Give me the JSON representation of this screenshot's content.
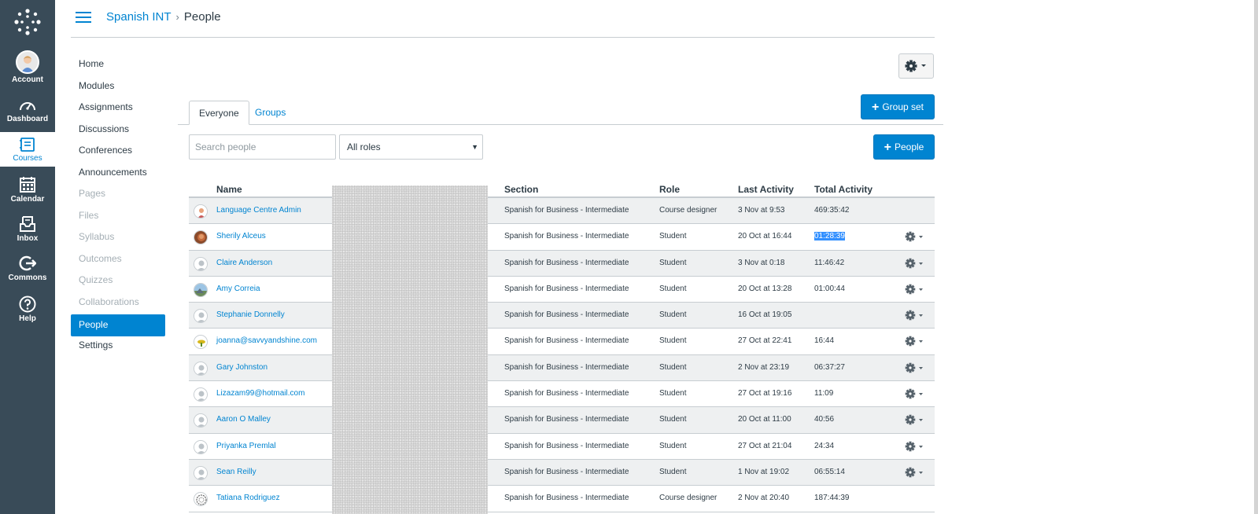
{
  "global_nav": [
    {
      "label": "Account",
      "icon": "account-avatar"
    },
    {
      "label": "Dashboard",
      "icon": "dashboard-icon"
    },
    {
      "label": "Courses",
      "icon": "courses-icon",
      "active": true
    },
    {
      "label": "Calendar",
      "icon": "calendar-icon"
    },
    {
      "label": "Inbox",
      "icon": "inbox-icon"
    },
    {
      "label": "Commons",
      "icon": "commons-icon"
    },
    {
      "label": "Help",
      "icon": "help-icon"
    }
  ],
  "breadcrumb": {
    "course": "Spanish INT",
    "separator": "›",
    "current": "People"
  },
  "course_nav": [
    {
      "label": "Home"
    },
    {
      "label": "Modules"
    },
    {
      "label": "Assignments"
    },
    {
      "label": "Discussions"
    },
    {
      "label": "Conferences"
    },
    {
      "label": "Announcements"
    },
    {
      "label": "Pages",
      "disabled": true
    },
    {
      "label": "Files",
      "disabled": true
    },
    {
      "label": "Syllabus",
      "disabled": true
    },
    {
      "label": "Outcomes",
      "disabled": true
    },
    {
      "label": "Quizzes",
      "disabled": true
    },
    {
      "label": "Collaborations",
      "disabled": true
    },
    {
      "label": "People",
      "active": true
    },
    {
      "label": "Settings"
    }
  ],
  "tabs": {
    "everyone": "Everyone",
    "groups": "Groups"
  },
  "buttons": {
    "group_set": "Group set",
    "people": "People",
    "plus": "+"
  },
  "filters": {
    "search_placeholder": "Search people",
    "role_selected": "All roles"
  },
  "table": {
    "headers": {
      "name": "Name",
      "section": "Section",
      "role": "Role",
      "last_activity": "Last Activity",
      "total_activity": "Total Activity"
    },
    "rows": [
      {
        "name": "Language Centre Admin",
        "section": "Spanish for Business - Intermediate",
        "role": "Course designer",
        "last": "3 Nov at 9:53",
        "total": "469:35:42",
        "gear": false,
        "avatar": "custom"
      },
      {
        "name": "Sherily Alceus",
        "section": "Spanish for Business - Intermediate",
        "role": "Student",
        "last": "20 Oct at 16:44",
        "total": "01:28:39",
        "gear": true,
        "avatar": "photo",
        "selected": true
      },
      {
        "name": "Claire Anderson",
        "section": "Spanish for Business - Intermediate",
        "role": "Student",
        "last": "3 Nov at 0:18",
        "total": "11:46:42",
        "gear": true,
        "avatar": "default"
      },
      {
        "name": "Amy Correia",
        "section": "Spanish for Business - Intermediate",
        "role": "Student",
        "last": "20 Oct at 13:28",
        "total": "01:00:44",
        "gear": true,
        "avatar": "landscape"
      },
      {
        "name": "Stephanie Donnelly",
        "section": "Spanish for Business - Intermediate",
        "role": "Student",
        "last": "16 Oct at 19:05",
        "total": "",
        "gear": true,
        "avatar": "default"
      },
      {
        "name": "joanna@savvyandshine.com",
        "section": "Spanish for Business - Intermediate",
        "role": "Student",
        "last": "27 Oct at 22:41",
        "total": "16:44",
        "gear": true,
        "avatar": "logo"
      },
      {
        "name": "Gary Johnston",
        "section": "Spanish for Business - Intermediate",
        "role": "Student",
        "last": "2 Nov at 23:19",
        "total": "06:37:27",
        "gear": true,
        "avatar": "default"
      },
      {
        "name": "Lizazam99@hotmail.com",
        "section": "Spanish for Business - Intermediate",
        "role": "Student",
        "last": "27 Oct at 19:16",
        "total": "11:09",
        "gear": true,
        "avatar": "default"
      },
      {
        "name": "Aaron O Malley",
        "section": "Spanish for Business - Intermediate",
        "role": "Student",
        "last": "20 Oct at 11:00",
        "total": "40:56",
        "gear": true,
        "avatar": "default"
      },
      {
        "name": "Priyanka Premlal",
        "section": "Spanish for Business - Intermediate",
        "role": "Student",
        "last": "27 Oct at 21:04",
        "total": "24:34",
        "gear": true,
        "avatar": "default"
      },
      {
        "name": "Sean Reilly",
        "section": "Spanish for Business - Intermediate",
        "role": "Student",
        "last": "1 Nov at 19:02",
        "total": "06:55:14",
        "gear": true,
        "avatar": "default"
      },
      {
        "name": "Tatiana Rodriguez",
        "section": "Spanish for Business - Intermediate",
        "role": "Course designer",
        "last": "2 Nov at 20:40",
        "total": "187:44:39",
        "gear": false,
        "avatar": "pattern"
      }
    ]
  },
  "colors": {
    "accent": "#0084d1",
    "nav_bg": "#394b58",
    "row_alt": "#eef0f1",
    "selection": "#3390ff"
  }
}
